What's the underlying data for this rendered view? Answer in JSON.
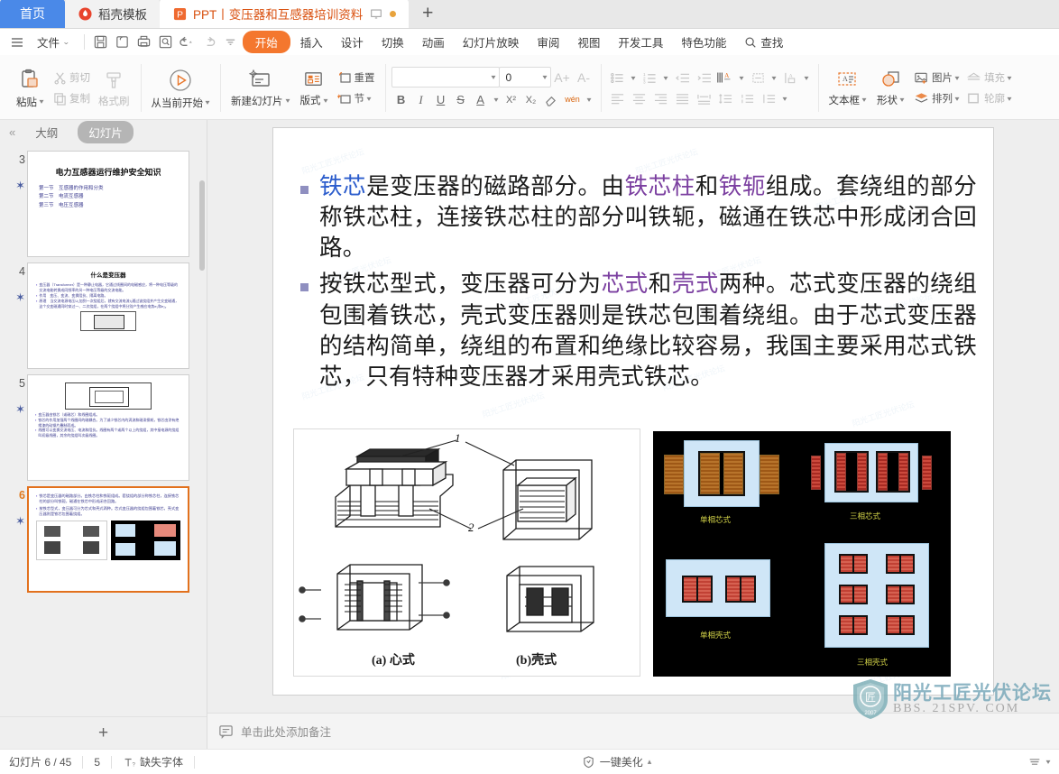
{
  "tabs": [
    {
      "label": "首页",
      "kind": "home",
      "icon": null
    },
    {
      "label": "稻壳模板",
      "kind": "light",
      "icon": "rice-husk-icon"
    },
    {
      "label": "PPT丨变压器和互感器培训资料",
      "kind": "active",
      "icon": "ppt-file-icon"
    }
  ],
  "newtab_label": "+",
  "menubar": {
    "file_label": "文件",
    "quick_icons": [
      "save-icon",
      "save-as-icon",
      "print-icon",
      "print-preview-icon",
      "undo-icon",
      "redo-icon",
      "customize-icon"
    ],
    "items": [
      {
        "label": "开始",
        "active": true
      },
      {
        "label": "插入",
        "active": false
      },
      {
        "label": "设计",
        "active": false
      },
      {
        "label": "切换",
        "active": false
      },
      {
        "label": "动画",
        "active": false
      },
      {
        "label": "幻灯片放映",
        "active": false
      },
      {
        "label": "审阅",
        "active": false
      },
      {
        "label": "视图",
        "active": false
      },
      {
        "label": "开发工具",
        "active": false
      },
      {
        "label": "特色功能",
        "active": false
      }
    ],
    "search_label": "查找"
  },
  "ribbon": {
    "clipboard": {
      "paste": "粘贴",
      "cut": "剪切",
      "copy": "复制",
      "format_painter": "格式刷"
    },
    "present": {
      "from_current": "从当前开始"
    },
    "slides": {
      "new_slide": "新建幻灯片",
      "layout": "版式",
      "section": "节",
      "reset": "重置"
    },
    "font": {
      "name_value": "",
      "name_placeholder": "",
      "size_value": "0",
      "grow": "A+",
      "shrink": "A-",
      "bold": "B",
      "italic": "I",
      "underline": "U",
      "strike": "S",
      "text_color": "A",
      "superscript": "X²",
      "subscript": "X₂",
      "clear_format": "clear-format-icon",
      "pinyin": "wén"
    },
    "paragraph": {
      "bullets": "bullet-list-icon",
      "numbering": "numbered-list-icon",
      "decrease_indent": "decrease-indent-icon",
      "increase_indent": "increase-indent-icon",
      "text_direction": "text-direction-icon",
      "align_text": "align-text-icon",
      "columns": "columns-icon",
      "align_left": "align-left-icon",
      "align_center": "align-center-icon",
      "align_right": "align-right-icon",
      "justify": "justify-icon",
      "distribute": "distribute-icon",
      "line_spacing_a": "line-spacing-icon",
      "line_spacing_b": "paragraph-spacing-icon",
      "line_spacing_c": "line-height-icon"
    },
    "insert": {
      "textbox": "文本框",
      "shape": "形状",
      "picture": "图片",
      "arrange": "排列",
      "fill": "填充",
      "outline": "轮廓"
    }
  },
  "sidebar": {
    "collapse": "«",
    "tab_outline": "大纲",
    "tab_slides": "幻灯片",
    "add_slide": "+",
    "thumbs": [
      {
        "num": "3",
        "selected": false,
        "title": "电力互感器运行维护安全知识",
        "lines": [
          "第一节　互感器的作用和分类",
          "第二节　电流互感器",
          "第三节　电压互感器"
        ]
      },
      {
        "num": "4",
        "selected": false,
        "title": "什么是变压器",
        "lines": [
          "变压器（Transformer）是一种静止电器，它通过线圈间的电磁感应，将一种电压等级的交流电能转换成同频率的另一种电压等级的交流电能。",
          "作用　变压、变流、变换阻抗、隔离电路。",
          "原理　当交流电源电压U₁加到一次绕组后，就有交流电流I₁通过该绕组并产生交变磁通，这个交变磁通同时穿过一、二次绕组，在两个绕组中将分别产生感应电势e₁和e₂。"
        ]
      },
      {
        "num": "5",
        "selected": false,
        "title": "",
        "lines": [
          "变压器由铁芯（或磁芯）和线圈组成。",
          "铁芯的作用加强两个线圈间的磁耦合。为了减少铁芯内的涡流和磁滞损耗，铁芯由涂有绝缘漆的硅钢片叠制而成。",
          "线圈可以变换交流电压、电流和阻抗。线圈有两个或两个以上的绕组，其中接电源的绕组叫初级线圈，其余的绕组叫次级线圈。"
        ]
      },
      {
        "num": "6",
        "selected": true,
        "title": "",
        "lines": [
          "铁芯是变压器的磁路部分。由铁芯柱和铁轭组成。套绕组的部分称铁芯柱，连接铁芯柱的部分叫铁轭，磁通在铁芯中形成闭合回路。",
          "按铁芯型式，变压器可分为芯式和壳式两种。芯式变压器的绕组包围着铁芯，壳式变压器则是铁芯包围着绕组。"
        ]
      }
    ]
  },
  "slide": {
    "bullets": [
      {
        "parts": [
          {
            "text": "铁芯",
            "style": "blue"
          },
          {
            "text": "是变压器的磁路部分。由",
            "style": "plain"
          },
          {
            "text": "铁芯柱",
            "style": "purple"
          },
          {
            "text": "和",
            "style": "plain"
          },
          {
            "text": "铁轭",
            "style": "purple"
          },
          {
            "text": "组成。套绕组的部分称铁芯柱，连接铁芯柱的部分叫铁轭，磁通在铁芯中形成闭合回路。",
            "style": "plain"
          }
        ]
      },
      {
        "parts": [
          {
            "text": "按铁芯型式，变压器可分为",
            "style": "plain"
          },
          {
            "text": "芯式",
            "style": "purple"
          },
          {
            "text": "和",
            "style": "plain"
          },
          {
            "text": "壳式",
            "style": "purple"
          },
          {
            "text": "两种。芯式变压器的绕组包围着铁芯，壳式变压器则是铁芯包围着绕组。由于芯式变压器的结构简单，绕组的布置和绝缘比较容易，我国主要采用芯式铁芯，只有特种变压器才采用壳式铁芯。",
            "style": "plain"
          }
        ]
      }
    ],
    "figure_left": {
      "caption_a": "(a) 心式",
      "caption_b": "(b)壳式",
      "callout_1": "1",
      "callout_2": "2"
    },
    "figure_right": {
      "labels": [
        "单相芯式",
        "三相芯式",
        "单相壳式",
        "三相壳式"
      ]
    },
    "watermark_text": "阳光工匠光伏论坛"
  },
  "notes": {
    "placeholder": "单击此处添加备注",
    "icon": "notes-icon"
  },
  "watermark_logo": {
    "cn": "阳光工匠光伏论坛",
    "en": "BBS. 21SPV. COM",
    "year": "2007"
  },
  "status": {
    "slide_count": "幻灯片 6 / 45",
    "word_count": "5",
    "missing_font": "缺失字体",
    "beautify": "一键美化",
    "beautify_caret": "▴"
  },
  "colors": {
    "accent_orange": "#f4772e",
    "tab_home_blue": "#4a89e8",
    "selected_thumb": "#e2711d",
    "bullet_blue": "#2b5ccc",
    "bullet_purple": "#7b3fa0"
  }
}
